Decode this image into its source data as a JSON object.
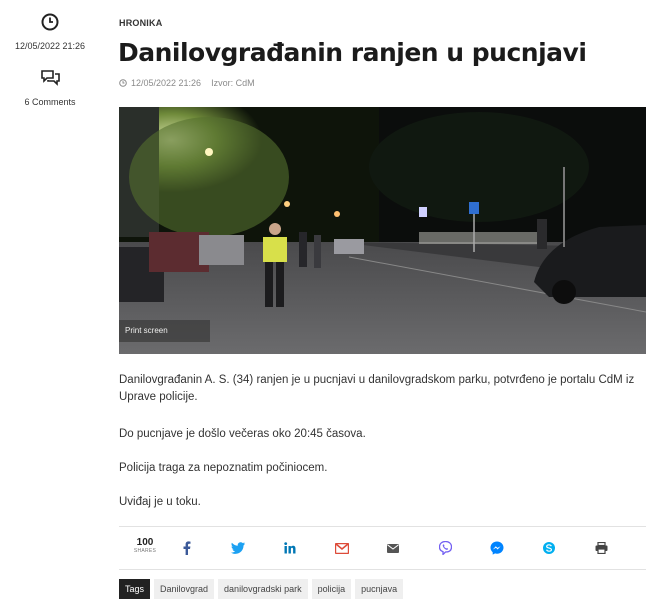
{
  "sidebar": {
    "date": "12/05/2022 21:26",
    "comments": "6 Comments"
  },
  "article": {
    "category": "HRONIKA",
    "title": "Danilovgrađanin ranjen u pucnjavi",
    "meta_date": "12/05/2022 21:26",
    "source": "Izvor: CdM",
    "photo_caption": "Print screen",
    "paragraphs": [
      "Danilovgrađanin A. S. (34) ranjen je u pucnjavi u danilovgradskom parku, potvrđeno je portalu CdM iz Uprave policije.",
      "Do pucnjave je došlo večeras oko 20:45 časova.",
      "Policija traga za nepoznatim počiniocem.",
      "Uviđaj je u toku."
    ]
  },
  "share": {
    "count": "100",
    "count_label": "SHARES",
    "icons": [
      "facebook-icon",
      "twitter-icon",
      "linkedin-icon",
      "gmail-icon",
      "email-icon",
      "viber-icon",
      "messenger-icon",
      "skype-icon",
      "print-icon"
    ],
    "colors": {
      "facebook": "#3b5998",
      "twitter": "#1da1f2",
      "linkedin": "#0077b5",
      "gmail": "#dd4b39",
      "email": "#555555",
      "viber": "#7360f2",
      "messenger": "#0084ff",
      "skype": "#00aff0",
      "print": "#444444"
    }
  },
  "tags": {
    "label": "Tags",
    "items": [
      "Danilovgrad",
      "danilovgradski park",
      "policija",
      "pucnjava"
    ]
  }
}
